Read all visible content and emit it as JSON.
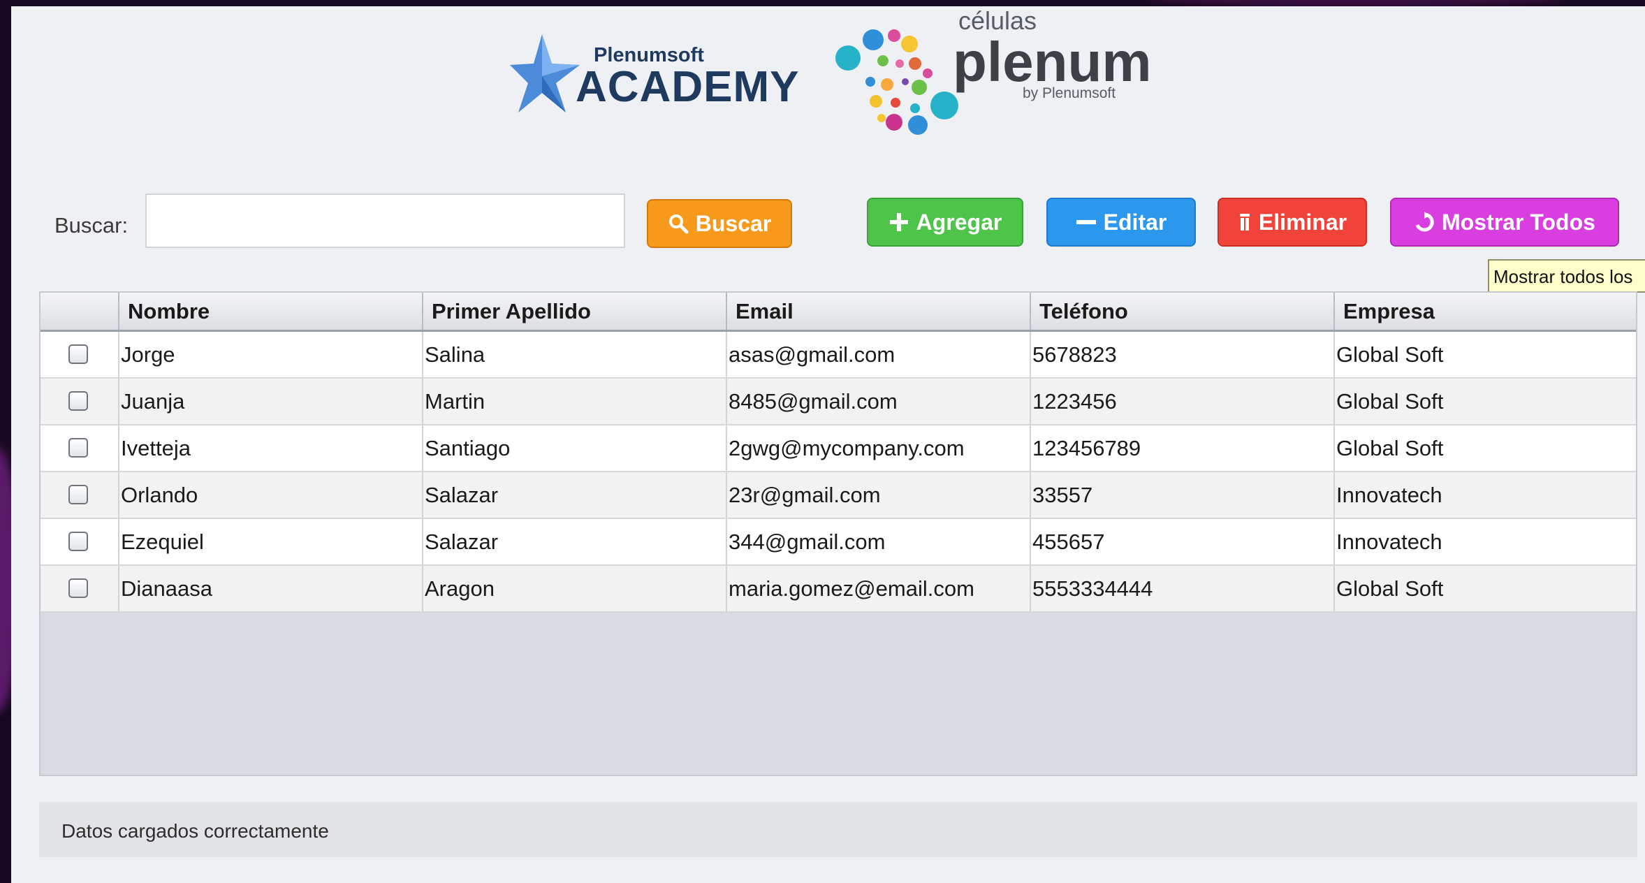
{
  "brand": {
    "academy_sub": "Plenumsoft",
    "academy_main": "ACADEMY",
    "celulas_top": "células",
    "celulas_main": "plenum",
    "celulas_by": "by Plenumsoft"
  },
  "search": {
    "label": "Buscar:",
    "value": "",
    "placeholder": ""
  },
  "toolbar": {
    "buscar_label": "Buscar",
    "agregar_label": "Agregar",
    "editar_label": "Editar",
    "eliminar_label": "Eliminar",
    "mostrar_label": "Mostrar Todos"
  },
  "tooltip": "Mostrar todos los",
  "table": {
    "headers": [
      "Nombre",
      "Primer Apellido",
      "Email",
      "Teléfono",
      "Empresa"
    ],
    "rows": [
      [
        "Jorge",
        "Salina",
        "asas@gmail.com",
        "5678823",
        "Global Soft"
      ],
      [
        "Juanja",
        "Martin",
        "8485@gmail.com",
        "1223456",
        "Global Soft"
      ],
      [
        "Ivetteja",
        "Santiago",
        "2gwg@mycompany.com",
        "123456789",
        "Global Soft"
      ],
      [
        "Orlando",
        "Salazar",
        "23r@gmail.com",
        "33557",
        "Innovatech"
      ],
      [
        "Ezequiel",
        "Salazar",
        "344@gmail.com",
        "455657",
        "Innovatech"
      ],
      [
        "Dianaasa",
        "Aragon",
        "maria.gomez@email.com",
        "5553334444",
        "Global Soft"
      ]
    ]
  },
  "status": "Datos cargados correctamente",
  "colors": {
    "buscar": "#f7991b",
    "agregar": "#4fc44b",
    "editar": "#2b98ee",
    "eliminar": "#f0433a",
    "mostrar": "#d83ee0"
  }
}
